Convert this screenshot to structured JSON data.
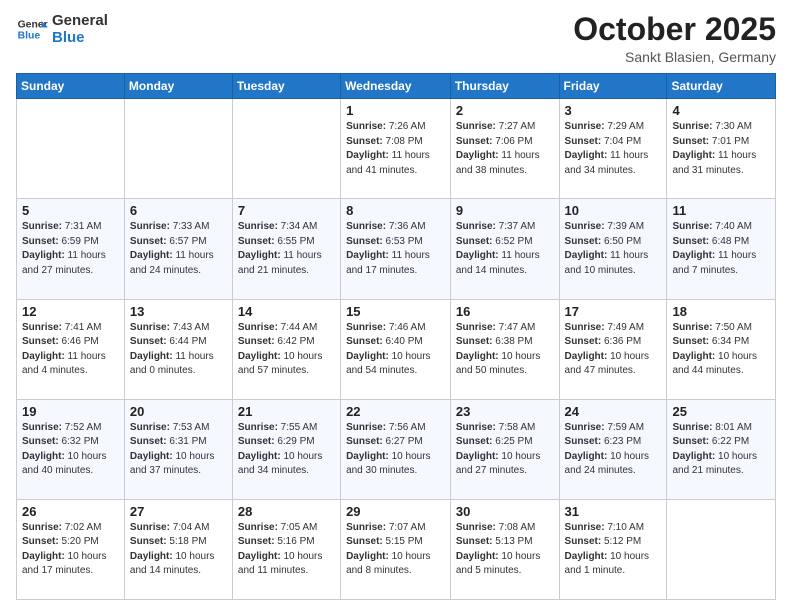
{
  "header": {
    "logo_general": "General",
    "logo_blue": "Blue",
    "month": "October 2025",
    "location": "Sankt Blasien, Germany"
  },
  "days_of_week": [
    "Sunday",
    "Monday",
    "Tuesday",
    "Wednesday",
    "Thursday",
    "Friday",
    "Saturday"
  ],
  "weeks": [
    [
      {
        "day": "",
        "info": ""
      },
      {
        "day": "",
        "info": ""
      },
      {
        "day": "",
        "info": ""
      },
      {
        "day": "1",
        "info": "Sunrise: 7:26 AM\nSunset: 7:08 PM\nDaylight: 11 hours\nand 41 minutes."
      },
      {
        "day": "2",
        "info": "Sunrise: 7:27 AM\nSunset: 7:06 PM\nDaylight: 11 hours\nand 38 minutes."
      },
      {
        "day": "3",
        "info": "Sunrise: 7:29 AM\nSunset: 7:04 PM\nDaylight: 11 hours\nand 34 minutes."
      },
      {
        "day": "4",
        "info": "Sunrise: 7:30 AM\nSunset: 7:01 PM\nDaylight: 11 hours\nand 31 minutes."
      }
    ],
    [
      {
        "day": "5",
        "info": "Sunrise: 7:31 AM\nSunset: 6:59 PM\nDaylight: 11 hours\nand 27 minutes."
      },
      {
        "day": "6",
        "info": "Sunrise: 7:33 AM\nSunset: 6:57 PM\nDaylight: 11 hours\nand 24 minutes."
      },
      {
        "day": "7",
        "info": "Sunrise: 7:34 AM\nSunset: 6:55 PM\nDaylight: 11 hours\nand 21 minutes."
      },
      {
        "day": "8",
        "info": "Sunrise: 7:36 AM\nSunset: 6:53 PM\nDaylight: 11 hours\nand 17 minutes."
      },
      {
        "day": "9",
        "info": "Sunrise: 7:37 AM\nSunset: 6:52 PM\nDaylight: 11 hours\nand 14 minutes."
      },
      {
        "day": "10",
        "info": "Sunrise: 7:39 AM\nSunset: 6:50 PM\nDaylight: 11 hours\nand 10 minutes."
      },
      {
        "day": "11",
        "info": "Sunrise: 7:40 AM\nSunset: 6:48 PM\nDaylight: 11 hours\nand 7 minutes."
      }
    ],
    [
      {
        "day": "12",
        "info": "Sunrise: 7:41 AM\nSunset: 6:46 PM\nDaylight: 11 hours\nand 4 minutes."
      },
      {
        "day": "13",
        "info": "Sunrise: 7:43 AM\nSunset: 6:44 PM\nDaylight: 11 hours\nand 0 minutes."
      },
      {
        "day": "14",
        "info": "Sunrise: 7:44 AM\nSunset: 6:42 PM\nDaylight: 10 hours\nand 57 minutes."
      },
      {
        "day": "15",
        "info": "Sunrise: 7:46 AM\nSunset: 6:40 PM\nDaylight: 10 hours\nand 54 minutes."
      },
      {
        "day": "16",
        "info": "Sunrise: 7:47 AM\nSunset: 6:38 PM\nDaylight: 10 hours\nand 50 minutes."
      },
      {
        "day": "17",
        "info": "Sunrise: 7:49 AM\nSunset: 6:36 PM\nDaylight: 10 hours\nand 47 minutes."
      },
      {
        "day": "18",
        "info": "Sunrise: 7:50 AM\nSunset: 6:34 PM\nDaylight: 10 hours\nand 44 minutes."
      }
    ],
    [
      {
        "day": "19",
        "info": "Sunrise: 7:52 AM\nSunset: 6:32 PM\nDaylight: 10 hours\nand 40 minutes."
      },
      {
        "day": "20",
        "info": "Sunrise: 7:53 AM\nSunset: 6:31 PM\nDaylight: 10 hours\nand 37 minutes."
      },
      {
        "day": "21",
        "info": "Sunrise: 7:55 AM\nSunset: 6:29 PM\nDaylight: 10 hours\nand 34 minutes."
      },
      {
        "day": "22",
        "info": "Sunrise: 7:56 AM\nSunset: 6:27 PM\nDaylight: 10 hours\nand 30 minutes."
      },
      {
        "day": "23",
        "info": "Sunrise: 7:58 AM\nSunset: 6:25 PM\nDaylight: 10 hours\nand 27 minutes."
      },
      {
        "day": "24",
        "info": "Sunrise: 7:59 AM\nSunset: 6:23 PM\nDaylight: 10 hours\nand 24 minutes."
      },
      {
        "day": "25",
        "info": "Sunrise: 8:01 AM\nSunset: 6:22 PM\nDaylight: 10 hours\nand 21 minutes."
      }
    ],
    [
      {
        "day": "26",
        "info": "Sunrise: 7:02 AM\nSunset: 5:20 PM\nDaylight: 10 hours\nand 17 minutes."
      },
      {
        "day": "27",
        "info": "Sunrise: 7:04 AM\nSunset: 5:18 PM\nDaylight: 10 hours\nand 14 minutes."
      },
      {
        "day": "28",
        "info": "Sunrise: 7:05 AM\nSunset: 5:16 PM\nDaylight: 10 hours\nand 11 minutes."
      },
      {
        "day": "29",
        "info": "Sunrise: 7:07 AM\nSunset: 5:15 PM\nDaylight: 10 hours\nand 8 minutes."
      },
      {
        "day": "30",
        "info": "Sunrise: 7:08 AM\nSunset: 5:13 PM\nDaylight: 10 hours\nand 5 minutes."
      },
      {
        "day": "31",
        "info": "Sunrise: 7:10 AM\nSunset: 5:12 PM\nDaylight: 10 hours\nand 1 minute."
      },
      {
        "day": "",
        "info": ""
      }
    ]
  ]
}
